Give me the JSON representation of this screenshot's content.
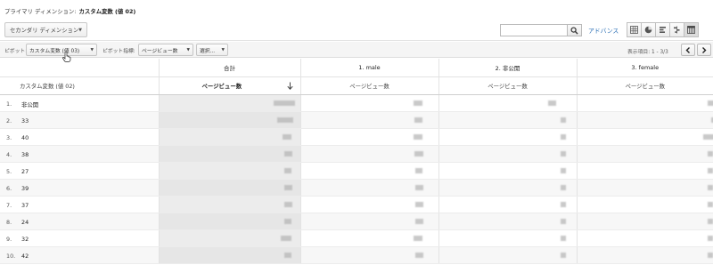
{
  "primary_dimension": {
    "label": "プライマリ ディメンション:",
    "value": "カスタム変数 (値 02)"
  },
  "toolbar": {
    "secondary_dimension_label": "セカンダリ ディメンション",
    "search_placeholder": "",
    "advanced_label": "アドバンス",
    "view_icons": [
      "grid-view-icon",
      "pie-view-icon",
      "bar-view-icon",
      "comparison-view-icon",
      "pivot-view-icon"
    ]
  },
  "pivot": {
    "pivot_by_label": "ピボット:",
    "pivot_by_value": "カスタム変数 (値 03)",
    "pivot_metric_label": "ピボット指標:",
    "pivot_metric_value": "ページビュー数",
    "select_value": "選択..."
  },
  "pager": {
    "label": "表示項目:",
    "range": "1 - 3/3"
  },
  "table": {
    "column_groups": [
      "合計",
      "1. male",
      "2. 非公開",
      "3. female"
    ],
    "dimension_header": "カスタム変数 (値 02)",
    "metric_header": "ページビュー数",
    "rows": [
      {
        "num": "1.",
        "value": "非公開"
      },
      {
        "num": "2.",
        "value": "33"
      },
      {
        "num": "3.",
        "value": "40"
      },
      {
        "num": "4.",
        "value": "38"
      },
      {
        "num": "5.",
        "value": "27"
      },
      {
        "num": "6.",
        "value": "39"
      },
      {
        "num": "7.",
        "value": "37"
      },
      {
        "num": "8.",
        "value": "24"
      },
      {
        "num": "9.",
        "value": "32"
      },
      {
        "num": "10.",
        "value": "42"
      }
    ]
  }
}
